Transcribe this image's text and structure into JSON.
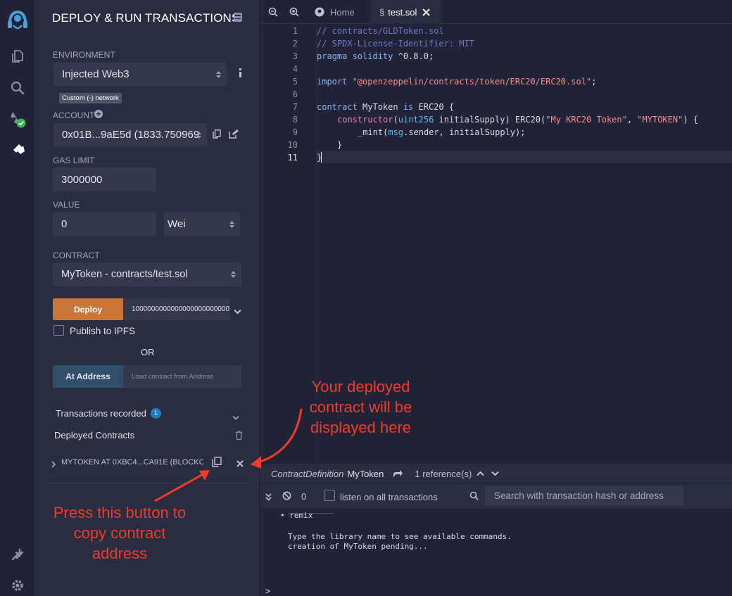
{
  "panel": {
    "title": "DEPLOY & RUN TRANSACTIONS",
    "environment_label": "ENVIRONMENT",
    "environment_value": "Injected Web3",
    "network_badge": "Custom (-) network",
    "account_label": "ACCOUNT",
    "account_value": "0x01B...9aE5d (1833.750969",
    "gas_limit_label": "GAS LIMIT",
    "gas_limit_value": "3000000",
    "value_label": "VALUE",
    "value_amount": "0",
    "value_unit": "Wei",
    "contract_label": "CONTRACT",
    "contract_value": "MyToken - contracts/test.sol",
    "deploy_label": "Deploy",
    "deploy_arg": "1000000000000000000000000",
    "publish_label": "Publish to IPFS",
    "or_label": "OR",
    "at_address_label": "At Address",
    "at_address_placeholder": "Load contract from Address",
    "transactions_label": "Transactions recorded",
    "transactions_count": "1",
    "deployed_label": "Deployed Contracts",
    "deployed_item": "MYTOKEN AT 0XBC4...CA91E (BLOCKCI"
  },
  "tabs": [
    {
      "label": "Home"
    },
    {
      "label": "test.sol"
    }
  ],
  "code": {
    "line_numbers": [
      "1",
      "2",
      "3",
      "4",
      "5",
      "6",
      "7",
      "8",
      "9",
      "10",
      "11"
    ],
    "l1": "// contracts/GLDToken.sol",
    "l2": "// SPDX-License-Identifier: MIT",
    "l3_kw": "pragma solidity",
    "l3_rest": " ^0.8.0;",
    "l5_kw": "import",
    "l5_str": " \"@openzeppelin/contracts/token/ERC20/ERC20.sol\"",
    "l5_end": ";",
    "l7_kw": "contract",
    "l7_name": " MyToken ",
    "l7_is": "is",
    "l7_rest": " ERC20 {",
    "l8_ctor": "constructor",
    "l8_p1": "(",
    "l8_type": "uint256",
    "l8_p2": " initialSupply) ERC20(",
    "l8_s1": "\"My KRC20 Token\"",
    "l8_p3": ", ",
    "l8_s2": "\"MYTOKEN\"",
    "l8_p4": ") {",
    "l9_a": "_mint(",
    "l9_msg": "msg",
    "l9_b": ".sender, initialSupply);",
    "l10": "}",
    "l11": "}"
  },
  "refbar": {
    "definition": "ContractDefinition",
    "name": "MyToken",
    "references": "1 reference(s)"
  },
  "terminal": {
    "count": "0",
    "listen_label": "listen on all transactions",
    "search_placeholder": "Search with transaction hash or address",
    "line_partial": "__________",
    "bullet": "remix",
    "line1": "Type the library name to see available commands.",
    "line2": "creation of MyToken pending...",
    "prompt": ">"
  },
  "annotations": {
    "top": "Your deployed contract will be displayed here",
    "bottom": "Press this button to copy contract address"
  },
  "colors": {
    "deploy": "#c97539",
    "at_address": "#30506a",
    "badge_blue": "#1f7fbf",
    "annotation": "#ee3b2b"
  }
}
